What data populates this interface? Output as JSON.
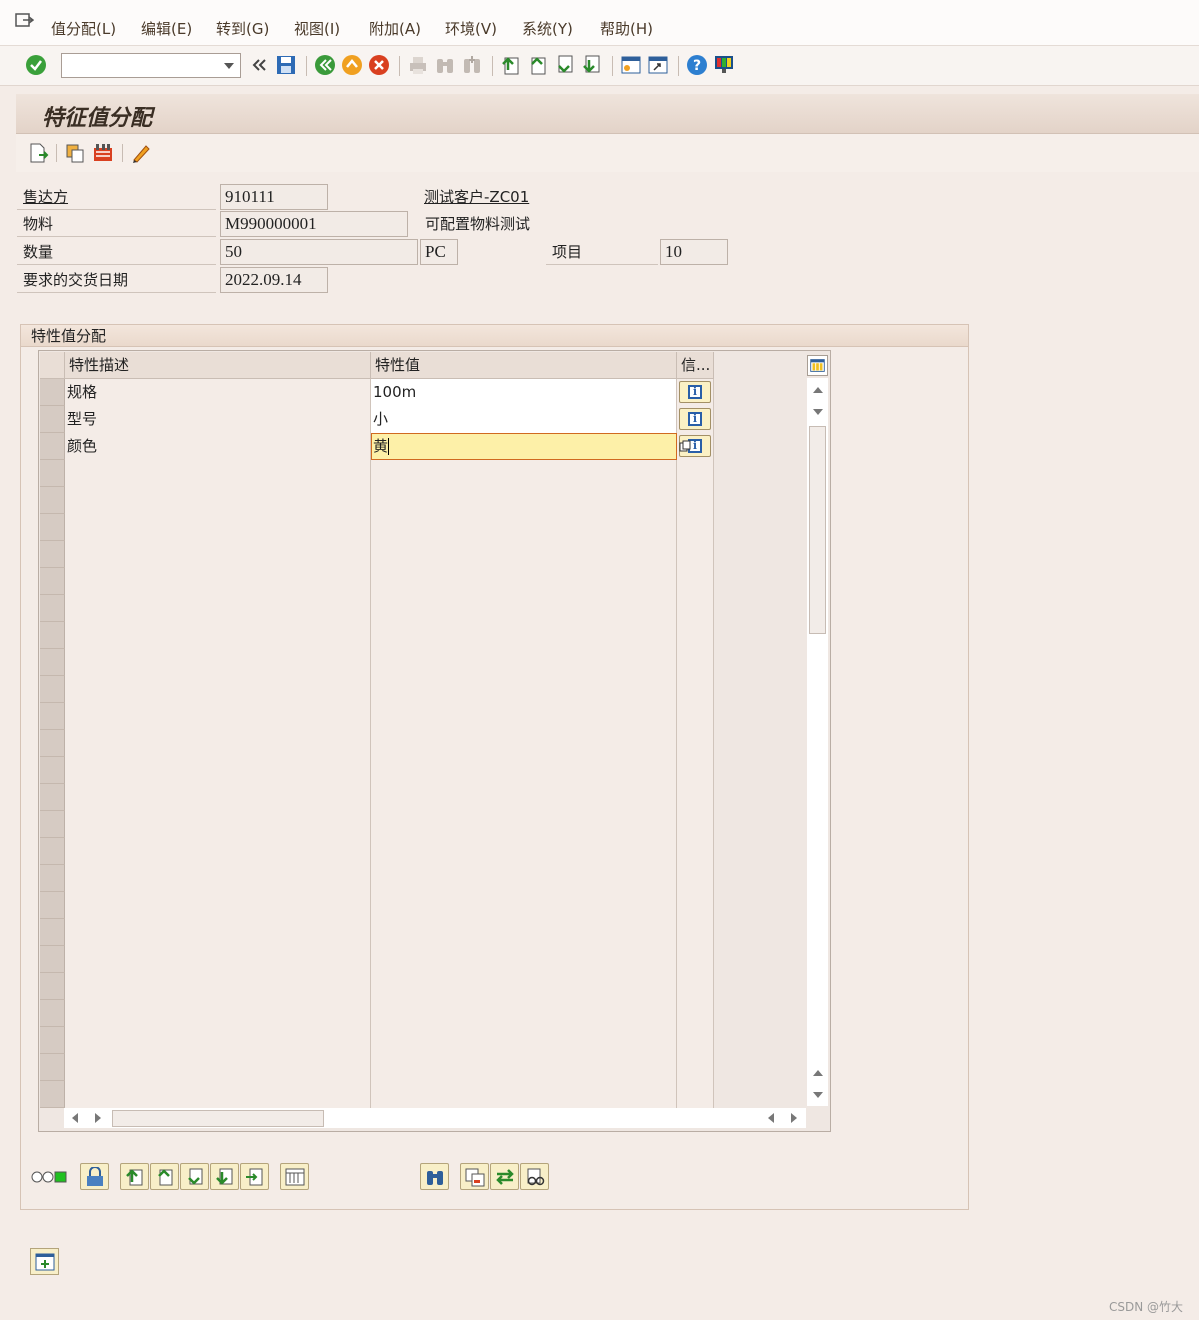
{
  "menubar": {
    "items": [
      "值分配(L)",
      "编辑(E)",
      "转到(G)",
      "视图(I)",
      "附加(A)",
      "环境(V)",
      "系统(Y)",
      "帮助(H)"
    ]
  },
  "toolbar": {
    "command_value": "",
    "icons": [
      "check-icon",
      "back-double-arrow-icon",
      "save-icon",
      "back-icon",
      "exit-icon",
      "cancel-icon",
      "print-icon",
      "find-icon",
      "find-next-icon",
      "first-page-icon",
      "previous-page-icon",
      "next-page-icon",
      "last-page-icon",
      "new-session-icon",
      "shortcut-icon",
      "help-icon",
      "customize-layout-icon"
    ]
  },
  "title": "特征值分配",
  "header": {
    "sold_to_label": "售达方",
    "sold_to_value": "910111",
    "sold_to_name": "测试客户-ZC01",
    "material_label": "物料",
    "material_value": "M990000001",
    "material_desc": "可配置物料测试",
    "qty_label": "数量",
    "qty_value": "50",
    "uom_value": "PC",
    "item_label": "项目",
    "item_value": "10",
    "date_label": "要求的交货日期",
    "date_value": "2022.09.14"
  },
  "group": {
    "title": "特性值分配"
  },
  "table": {
    "columns": [
      "特性描述",
      "特性值",
      "信..."
    ],
    "rows": [
      {
        "desc": "规格",
        "value": "100m"
      },
      {
        "desc": "型号",
        "value": "小"
      },
      {
        "desc": "颜色",
        "value": "黄"
      }
    ]
  },
  "watermark": "CSDN @竹大"
}
